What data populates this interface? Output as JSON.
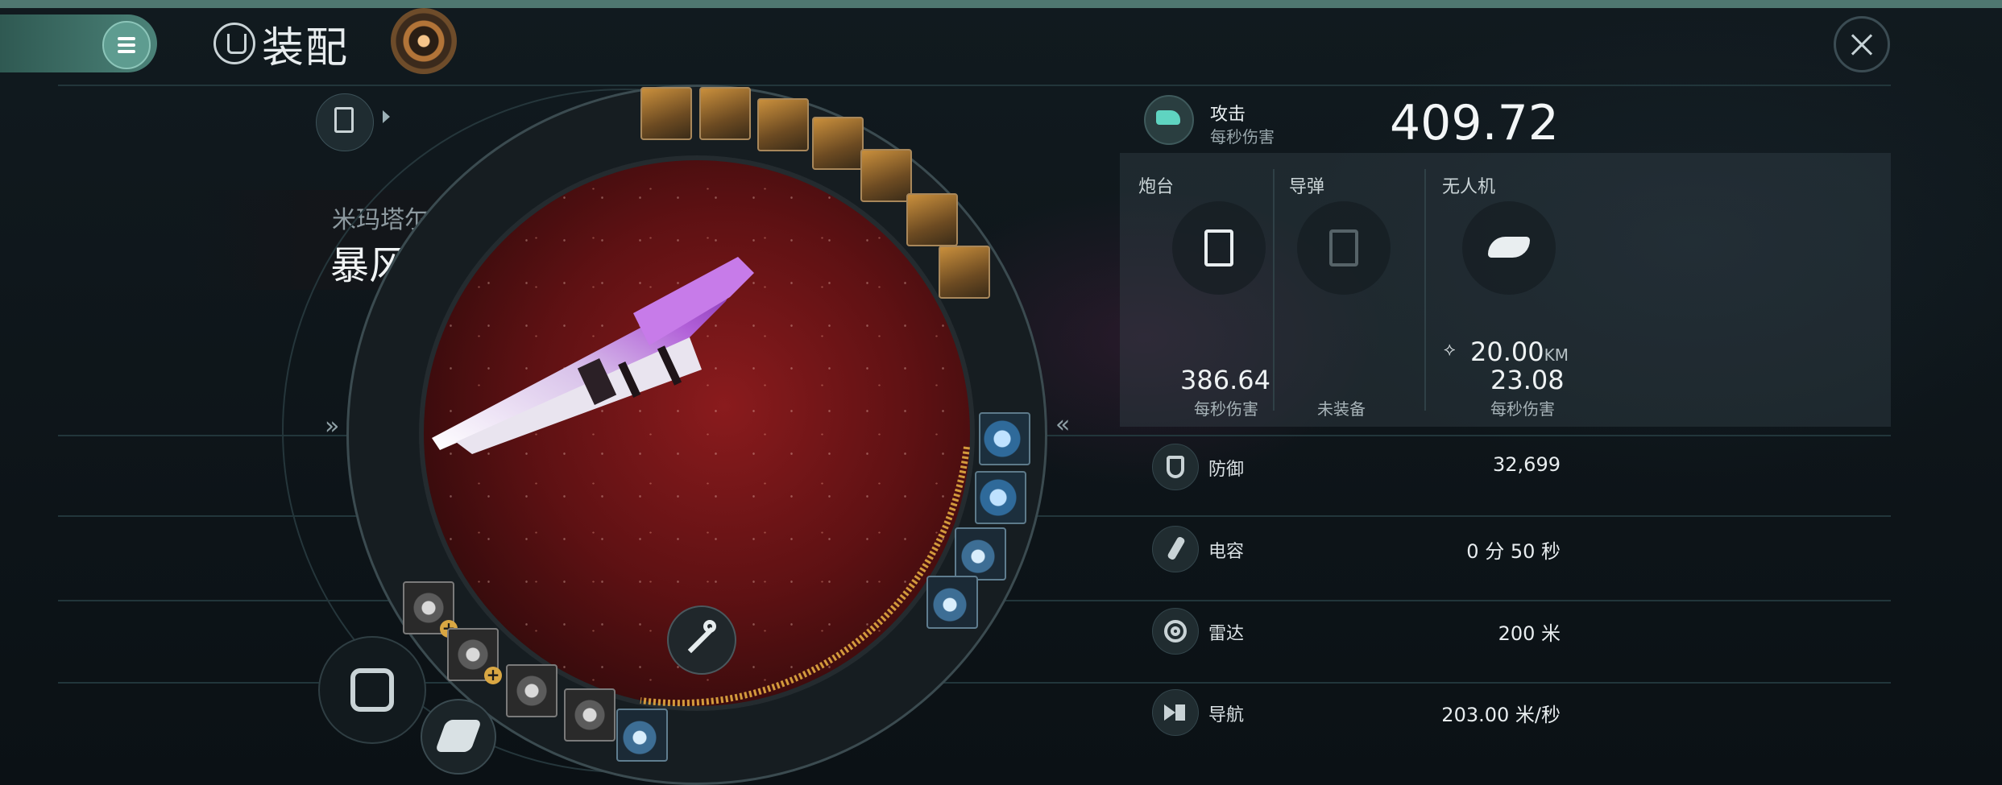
{
  "header": {
    "title": "装配"
  },
  "ship": {
    "race": "米玛塔尔",
    "class_name": "暴风级",
    "class_arrow": "»"
  },
  "dial": {
    "left_chevron": "»",
    "right_chevron": "«"
  },
  "stats": {
    "attack": {
      "label": "攻击",
      "sub": "每秒伤害",
      "value": "409.72"
    },
    "weapons": {
      "turret": {
        "label": "炮台",
        "value": "386.64",
        "sub": "每秒伤害",
        "icon": "turret-icon"
      },
      "missile": {
        "label": "导弹",
        "value": "",
        "sub": "未装备",
        "icon": "missile-icon"
      },
      "drone": {
        "label": "无人机",
        "range_value": "20.00",
        "range_unit": "KM",
        "value": "23.08",
        "sub": "每秒伤害",
        "icon": "drone-icon"
      }
    },
    "rows": [
      {
        "name": "防御",
        "value": "32,699",
        "icon": "shield-icon"
      },
      {
        "name": "电容",
        "value": "0 分 50 秒",
        "icon": "capacitor-icon"
      },
      {
        "name": "雷达",
        "value": "200 米",
        "icon": "radar-icon"
      },
      {
        "name": "导航",
        "value": "203.00 米/秒",
        "icon": "navigation-icon"
      }
    ]
  },
  "colors": {
    "accent": "#4b8278",
    "space_red": "#8a1b1d",
    "gold": "#d9a743"
  }
}
